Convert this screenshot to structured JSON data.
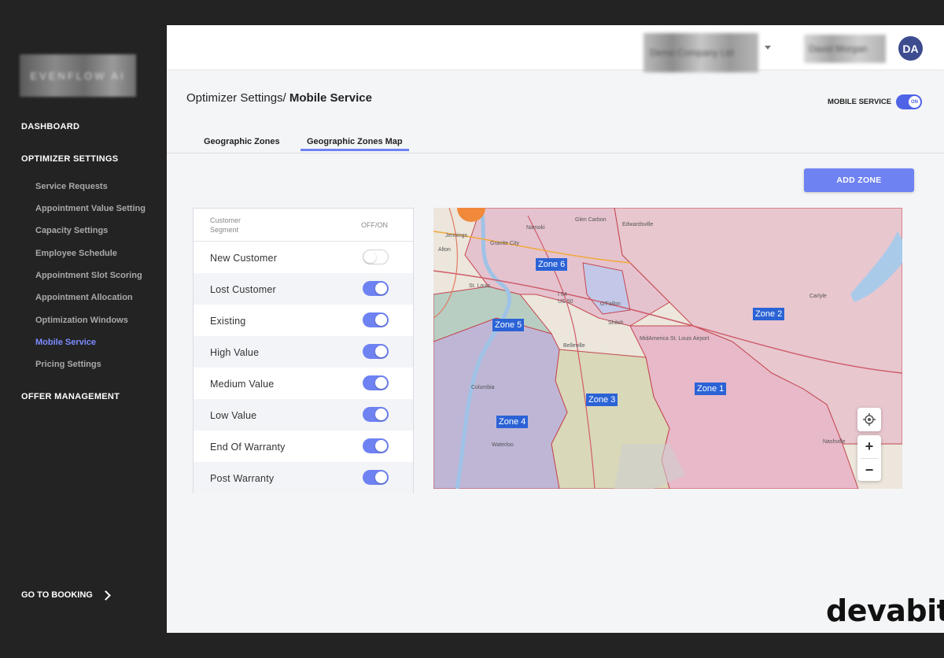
{
  "sidebar": {
    "logo_text": "EVENFLOW AI",
    "sections": [
      {
        "label": "DASHBOARD"
      },
      {
        "label": "OPTIMIZER SETTINGS"
      },
      {
        "label": "OFFER MANAGEMENT"
      }
    ],
    "sub_items": [
      {
        "label": "Service Requests"
      },
      {
        "label": "Appointment Value Setting"
      },
      {
        "label": "Capacity Settings"
      },
      {
        "label": "Employee Schedule"
      },
      {
        "label": "Appointment Slot Scoring"
      },
      {
        "label": "Appointment Allocation"
      },
      {
        "label": "Optimization Windows"
      },
      {
        "label": "Mobile Service"
      },
      {
        "label": "Pricing Settings"
      }
    ],
    "footer_link": "GO TO BOOKING"
  },
  "header": {
    "account_selector": "Demo Company Ltd",
    "user_name": "David Morgan",
    "avatar_initials": "DA"
  },
  "page": {
    "breadcrumb_parent": "Optimizer Settings/",
    "breadcrumb_current": "Mobile Service",
    "mobile_service_label": "MOBILE SERVICE",
    "mobile_service_toggle_text": "ON",
    "tabs": [
      {
        "label": "Geographic Zones"
      },
      {
        "label": "Geographic Zones Map"
      }
    ],
    "add_zone_label": "ADD ZONE"
  },
  "segments": {
    "header_segment": "Customer Segment",
    "header_toggle": "OFF/ON",
    "rows": [
      {
        "name": "New Customer",
        "on": false
      },
      {
        "name": "Lost Customer",
        "on": true
      },
      {
        "name": "Existing",
        "on": true
      },
      {
        "name": "High Value",
        "on": true
      },
      {
        "name": "Medium Value",
        "on": true
      },
      {
        "name": "Low Value",
        "on": true
      },
      {
        "name": "End Of Warranty",
        "on": true
      },
      {
        "name": "Post Warranty",
        "on": true
      }
    ]
  },
  "map": {
    "zones": [
      {
        "label": "Zone 6"
      },
      {
        "label": "Zone 5"
      },
      {
        "label": "Zone 2"
      },
      {
        "label": "Zone 1"
      },
      {
        "label": "Zone 3"
      },
      {
        "label": "Zone 4"
      }
    ],
    "place_labels": [
      "Glen Carbon",
      "Edwardsville",
      "Jennings",
      "St. Louis",
      "O'Fallon",
      "Shiloh",
      "Belleville",
      "MidAmerica St. Louis Airport",
      "Columbia",
      "Waterloo",
      "Carlyle",
      "Nashville",
      "Granite City",
      "Namoki",
      "Alton",
      "I 64",
      "US 50"
    ],
    "controls": {
      "zoom_in": "+",
      "zoom_out": "−"
    }
  },
  "watermark": "devabit",
  "colors": {
    "accent": "#6e82f2",
    "sidebar_bg": "#232323",
    "zone_label_bg": "#2b63d6",
    "active_nav": "#7c8cff"
  }
}
